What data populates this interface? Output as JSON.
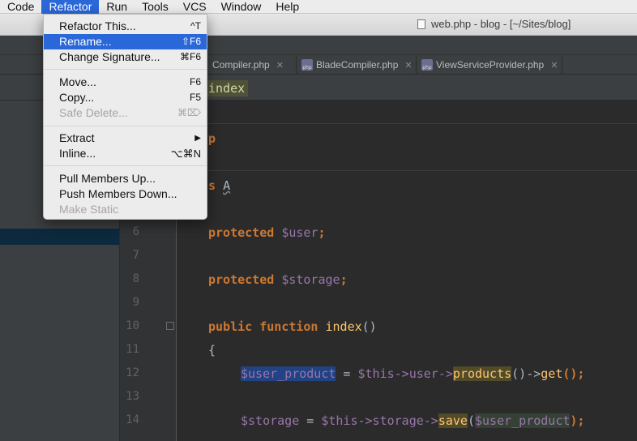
{
  "menubar": {
    "items": [
      "Code",
      "Refactor",
      "Run",
      "Tools",
      "VCS",
      "Window",
      "Help"
    ],
    "active": "Refactor"
  },
  "window": {
    "title": "web.php - blog - [~/Sites/blog]"
  },
  "tabs": [
    {
      "label": "Compiler.php"
    },
    {
      "label": "BladeCompiler.php"
    },
    {
      "label": "ViewServiceProvider.php"
    }
  ],
  "left_label": "e",
  "breadcrumb": "index",
  "refactor_menu": {
    "items": [
      {
        "label": "Refactor This...",
        "shortcut": "^T",
        "state": "normal"
      },
      {
        "label": "Rename...",
        "shortcut": "⇧F6",
        "state": "highlighted"
      },
      {
        "label": "Change Signature...",
        "shortcut": "⌘F6",
        "state": "normal"
      },
      {
        "label": "Move...",
        "shortcut": "F6",
        "state": "normal"
      },
      {
        "label": "Copy...",
        "shortcut": "F5",
        "state": "normal"
      },
      {
        "label": "Safe Delete...",
        "shortcut": "⌘⌦",
        "state": "disabled"
      },
      {
        "label": "Extract",
        "shortcut": "▶",
        "state": "normal"
      },
      {
        "label": "Inline...",
        "shortcut": "⌥⌘N",
        "state": "normal"
      },
      {
        "label": "Pull Members Up...",
        "shortcut": "",
        "state": "normal"
      },
      {
        "label": "Push Members Down...",
        "shortcut": "",
        "state": "normal"
      },
      {
        "label": "Make Static",
        "shortcut": "",
        "state": "disabled"
      }
    ]
  },
  "editor": {
    "line_numbers": [
      "6",
      "7",
      "8",
      "9",
      "10",
      "11",
      "12",
      "13",
      "14"
    ],
    "partial_line_1": "p",
    "partial_line_2_kw": "s",
    "partial_line_2_name": "A",
    "line6": {
      "kw": "protected",
      "var": "$user",
      "end": ";"
    },
    "line8": {
      "kw": "protected",
      "var": "$storage",
      "end": ";"
    },
    "line10": {
      "kw1": "public",
      "kw2": "function",
      "fn": "index",
      "end": "()"
    },
    "line11": "{",
    "line12": {
      "var": "$user_product",
      "op": " = ",
      "this": "$this",
      "arrow1": "->user->",
      "call": "products",
      "rest": "()->",
      "fn2": "get",
      "end": "();"
    },
    "line14": {
      "var": "$storage",
      "op": " = ",
      "this": "$this",
      "arrow1": "->storage->",
      "call": "save",
      "open": "(",
      "arg": "$user_product",
      "end": ");"
    }
  },
  "colors": {
    "menu_highlight": "#2a67d8",
    "keyword": "#cc7832",
    "variable": "#9876aa",
    "function": "#ffc66d",
    "editor_bg": "#2b2b2b"
  }
}
